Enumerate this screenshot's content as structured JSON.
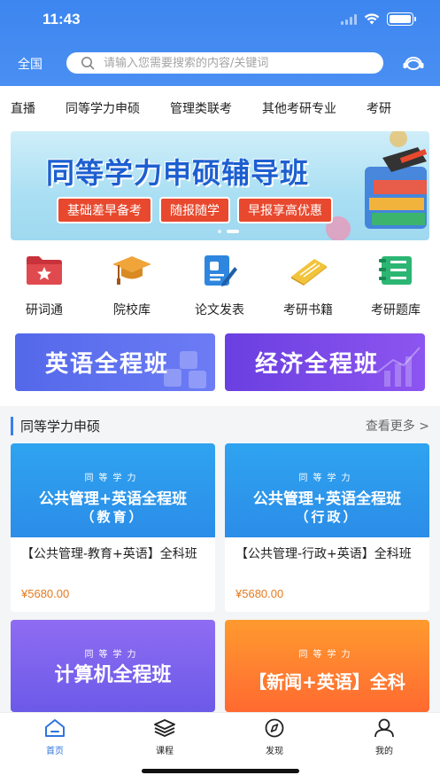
{
  "status": {
    "time": "11:43"
  },
  "header": {
    "city": "全国",
    "search_placeholder": "请输入您需要搜索的内容/关键词"
  },
  "nav": {
    "items": [
      "直播",
      "同等学力申硕",
      "管理类联考",
      "其他考研专业",
      "考研"
    ]
  },
  "banner": {
    "title": "同等学力申硕辅导班",
    "tags": [
      "基础差早备考",
      "随报随学",
      "早报享高优惠"
    ]
  },
  "shortcuts": [
    "研词通",
    "院校库",
    "论文发表",
    "考研书籍",
    "考研题库"
  ],
  "course_banners": [
    "英语全程班",
    "经济全程班"
  ],
  "section": {
    "title": "同等学力申硕",
    "more": "查看更多 >"
  },
  "cards": [
    {
      "tag": "同等学力",
      "headline": "公共管理+英语全程班",
      "sub": "（教育）",
      "name": "【公共管理-教育+英语】全科班",
      "price": "¥5680.00"
    },
    {
      "tag": "同等学力",
      "headline": "公共管理+英语全程班",
      "sub": "（行政）",
      "name": "【公共管理-行政+英语】全科班",
      "price": "¥5680.00"
    },
    {
      "tag": "同等学力",
      "headline": "计算机全程班"
    },
    {
      "tag": "同等学力",
      "headline": "【新闻+英语】全科"
    }
  ],
  "tabbar": {
    "items": [
      "首页",
      "课程",
      "发现",
      "我的"
    ]
  },
  "colors": {
    "primary": "#3d86f0",
    "price": "#e67a1e",
    "banner_tag": "#e8492e"
  }
}
